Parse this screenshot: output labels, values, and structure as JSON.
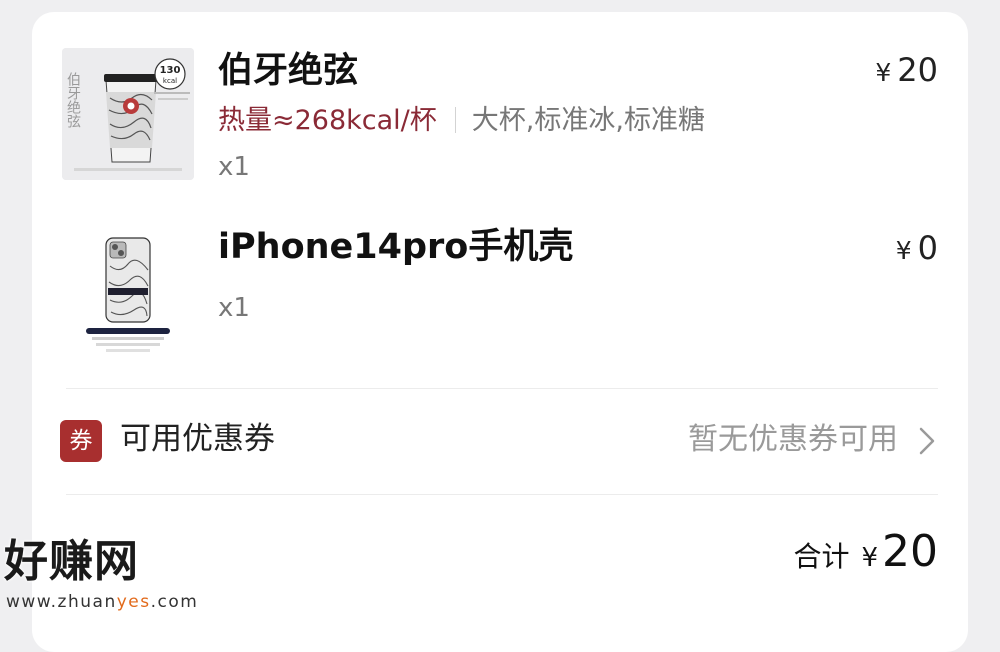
{
  "order_items": [
    {
      "title": "伯牙绝弦",
      "image_text": "伯牙绝弦",
      "image_badge_value": "130",
      "image_badge_unit": "kcal",
      "price_symbol": "¥",
      "price": "20",
      "calorie": "热量≈268kcal/杯",
      "spec": "大杯,标准冰,标准糖",
      "quantity": "x1"
    },
    {
      "title": "iPhone14pro手机壳",
      "price_symbol": "¥",
      "price": "0",
      "quantity": "x1"
    }
  ],
  "coupon": {
    "badge": "券",
    "label": "可用优惠券",
    "status": "暂无优惠券可用"
  },
  "summary": {
    "label": "合计",
    "currency": "¥",
    "amount": "20"
  },
  "watermark": {
    "logo": "好赚网",
    "url_prefix": "www.zhuan",
    "url_accent": "yes",
    "url_suffix": ".com"
  },
  "colors": {
    "background": "#efeff1",
    "card": "#ffffff",
    "calorie_text": "#8a2a36",
    "coupon_badge": "#a82f2f",
    "watermark_accent": "#e26a1b"
  }
}
